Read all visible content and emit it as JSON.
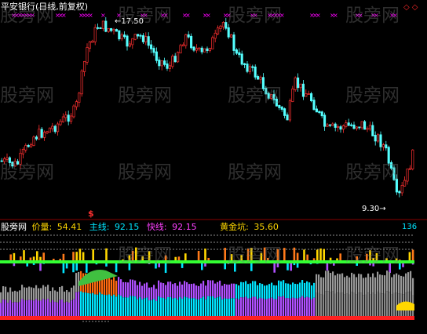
{
  "stock": {
    "name_title": "平安银行(日线,前复权)",
    "high_label": "17.50",
    "low_label": "9.30",
    "signal_mark": "$"
  },
  "indicator": {
    "name": "股旁网",
    "items": [
      {
        "label": "价量:",
        "value": "54.41",
        "color": "#ffd700"
      },
      {
        "label": "主线:",
        "value": "92.15",
        "color": "#00e5ff"
      },
      {
        "label": "快线:",
        "value": "92.15",
        "color": "#ff40ff"
      },
      {
        "label": "黄金坑:",
        "value": "35.60",
        "color": "#ffd700"
      }
    ],
    "right_value": "136"
  },
  "watermark": "股旁网",
  "nav": {
    "diamonds": "◇◇"
  },
  "colors": {
    "background": "#000000",
    "candle_up": "#ff3030",
    "candle_down": "#54ffff",
    "accent_green": "#33ff33",
    "accent_red": "#ff2020",
    "marker_magenta": "#ff00ff"
  }
}
